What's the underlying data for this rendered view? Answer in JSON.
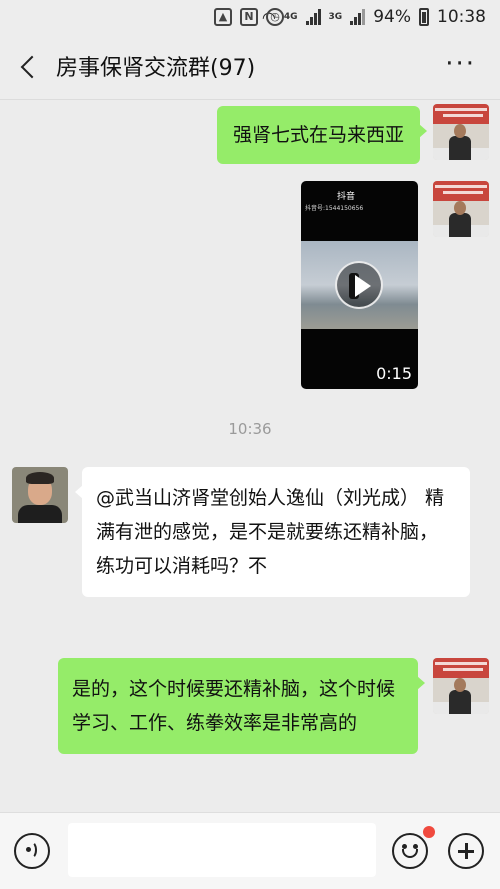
{
  "status_bar": {
    "network_4g": "4G",
    "network_3g": "3G",
    "battery": "94%",
    "time": "10:38"
  },
  "header": {
    "title": "房事保肾交流群(97)",
    "more_label": "···"
  },
  "messages": [
    {
      "side": "right",
      "type": "text",
      "text": "强肾七式在马来西亚"
    },
    {
      "side": "right",
      "type": "video",
      "source_logo": "抖音",
      "account_id": "抖音号:1544150656",
      "duration": "0:15"
    },
    {
      "type": "time",
      "text": "10:36"
    },
    {
      "side": "left",
      "type": "text",
      "text": "@武当山济肾堂创始人逸仙（刘光成） 精满有泄的感觉，是不是就要练还精补脑，练功可以消耗吗？不"
    },
    {
      "side": "right",
      "type": "text",
      "text": "是的，这个时候要还精补脑，这个时候学习、工作、练拳效率是非常高的"
    }
  ],
  "input": {
    "placeholder": "",
    "value": ""
  },
  "colors": {
    "own_bubble": "#95ec69",
    "other_bubble": "#ffffff",
    "background": "#ececec",
    "badge": "#f04a3e"
  },
  "icons": [
    "back-arrow-icon",
    "more-icon",
    "voice-icon",
    "emoji-icon",
    "plus-icon",
    "play-icon"
  ]
}
